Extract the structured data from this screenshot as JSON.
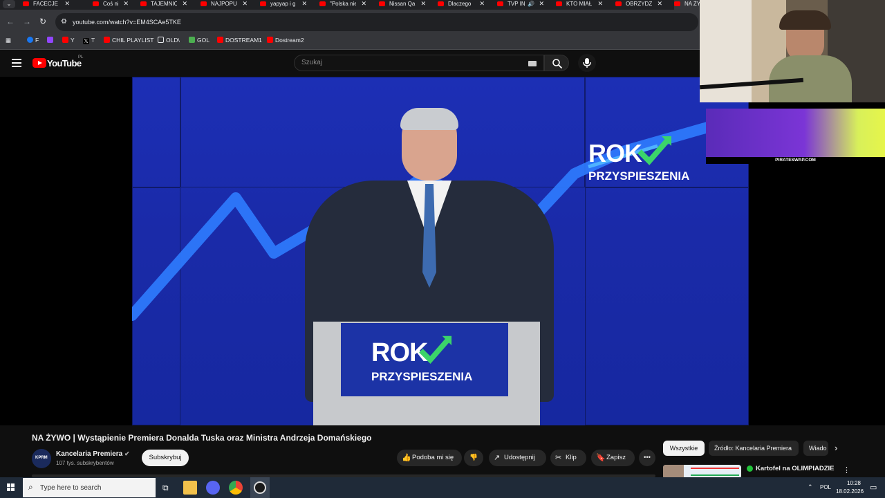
{
  "browser": {
    "tabs": [
      {
        "label": "FACECJE JE"
      },
      {
        "label": "Coś ni"
      },
      {
        "label": "TAJEMNIC"
      },
      {
        "label": "NAJPOPUl"
      },
      {
        "label": "yapyap i g"
      },
      {
        "label": "\"Polska nie"
      },
      {
        "label": "Nissan Qa"
      },
      {
        "label": "Dlaczego"
      },
      {
        "label": "TVP IN"
      },
      {
        "label": "KTO MIAŁ"
      },
      {
        "label": "OBRZYDZA"
      },
      {
        "label": "NA ŻY"
      }
    ],
    "url": "youtube.com/watch?v=EM4SCAe5TKE",
    "bookmarks": [
      {
        "label": "F",
        "color": "#1877f2"
      },
      {
        "label": "",
        "color": "#9146ff"
      },
      {
        "label": "Y",
        "color": "#ff0000"
      },
      {
        "label": "T",
        "color": "#000000"
      },
      {
        "label": "CHIL PLAYLIST",
        "color": "#ff0000"
      },
      {
        "label": "OLD\\",
        "color": "#35363a"
      },
      {
        "label": "GOL",
        "color": "#4caf50"
      },
      {
        "label": "DOSTREAM1",
        "color": "#ff0000"
      },
      {
        "label": "Dostream2",
        "color": "#ff0000"
      }
    ]
  },
  "youtube": {
    "logo_text": "YouTube",
    "country_code": "PL",
    "search_placeholder": "Szukaj"
  },
  "video": {
    "backdrop_text_1": "ROK",
    "backdrop_text_2": "PRZYSPIESZENIA",
    "podium_text_1": "ROK",
    "podium_text_2": "PRZYSPIESZENIA",
    "ad_url": "PIRATESWAP.COM"
  },
  "details": {
    "title": "NA ŻYWO | Wystąpienie Premiera Donalda Tuska oraz Ministra Andrzeja Domańskiego",
    "channel_name": "Kancelaria Premiera",
    "channel_avatar_text": "KPRM",
    "subscribers": "107 tys. subskrybentów",
    "subscribe_label": "Subskrybuj",
    "like_label": "Podoba mi się",
    "share_label": "Udostępnij",
    "clip_label": "Klip",
    "save_label": "Zapisz"
  },
  "sidebar": {
    "chips": [
      "Wszystkie",
      "Źródło: Kancelaria Premiera",
      "Wiado"
    ],
    "rec_title": "Kartofel na OLIMPIADZIE"
  },
  "taskbar": {
    "search_placeholder": "Type here to search",
    "lang": "POL",
    "time": "10:28",
    "date": "18.02.2026"
  }
}
